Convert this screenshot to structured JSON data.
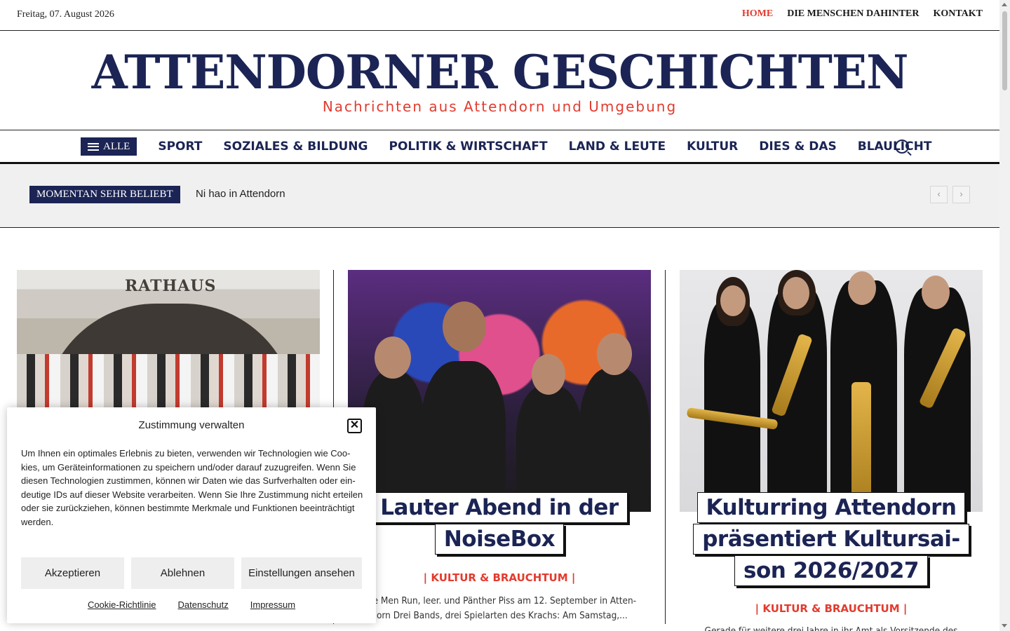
{
  "topbar": {
    "date": "Freitag, 07. August 2026",
    "links": [
      {
        "label": "HOME",
        "active": true
      },
      {
        "label": "DIE MENSCHEN DAHINTER",
        "active": false
      },
      {
        "label": "KONTAKT",
        "active": false
      }
    ]
  },
  "header": {
    "title": "ATTENDORNER GESCHICHTEN",
    "subtitle": "Nachrichten aus Attendorn und Umgebung"
  },
  "mainnav": {
    "all_label": "ALLE",
    "items": [
      "SPORT",
      "SOZIALES & BILDUNG",
      "POLITIK & WIRTSCHAFT",
      "LAND & LEUTE",
      "KULTUR",
      "DIES & DAS",
      "BLAULICHT"
    ],
    "search_icon": "search-icon"
  },
  "trending": {
    "badge": "MOMENTAN SEHR BELIEBT",
    "headline": "Ni hao in Attendorn",
    "prev": "‹",
    "next": "›"
  },
  "articles": [
    {
      "image_sign": "RATHAUS",
      "headline_lines": [],
      "category": "",
      "excerpt": ""
    },
    {
      "headline_lines": [
        "Lauter Abend in der",
        "NoiseBox"
      ],
      "category": "| KULTUR & BRAUCHTUM |",
      "excerpt": "ave Men Run, leer. und Pänther Piss am 12. September in Atten-dorn Drei Bands, drei Spielarten des Krachs: Am Samstag,..."
    },
    {
      "headline_lines": [
        "Kulturring Attendorn",
        "präsentiert Kultursai-",
        "son 2026/2027"
      ],
      "category": "| KULTUR & BRAUCHTUM |",
      "excerpt": "Gerade für weitere drei Jahre in ihr Amt als Vorsitzende des Kul..."
    }
  ],
  "cookie": {
    "title": "Zustimmung verwalten",
    "close": "✕",
    "text": "Um Ihnen ein optimales Erlebnis zu bieten, verwenden wir Technologien wie Coo-kies, um Geräteinformationen zu speichern und/oder darauf zuzugreifen. Wenn Sie diesen Technologien zustimmen, können wir Daten wie das Surfverhalten oder ein-deutige IDs auf dieser Website verarbeiten. Wenn Sie Ihre Zustimmung nicht erteilen oder sie zurückziehen, können bestimmte Merkmale und Funktionen beeinträchtigt werden.",
    "accept": "Akzeptieren",
    "deny": "Ablehnen",
    "preferences": "Einstellungen ansehen",
    "links": [
      "Cookie-Richtlinie",
      "Datenschutz",
      "Impressum"
    ]
  },
  "colors": {
    "brand_navy": "#1b2454",
    "accent_red": "#e33b2e"
  }
}
